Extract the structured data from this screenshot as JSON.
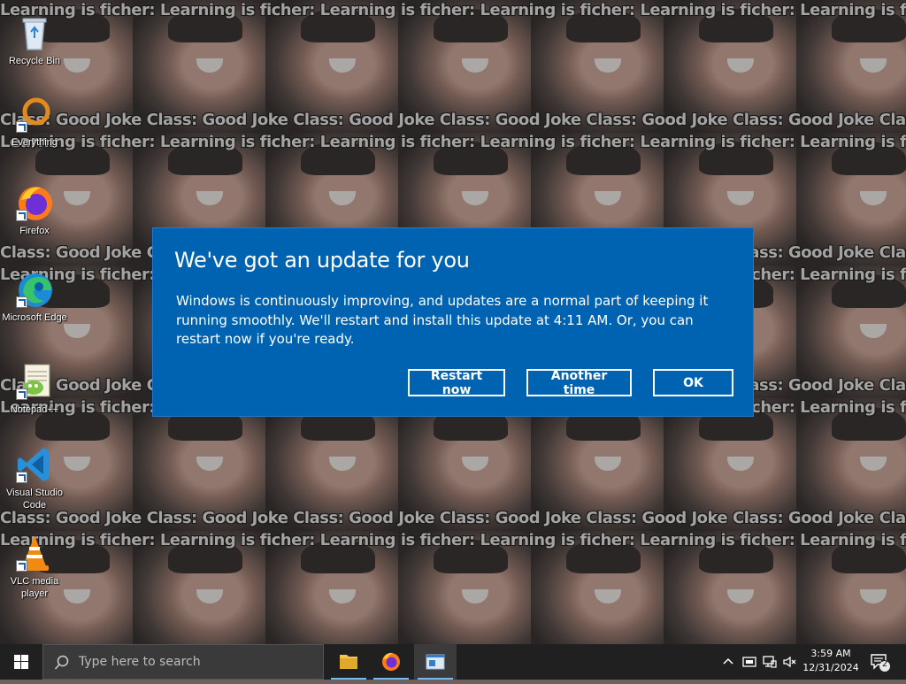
{
  "wallpaper": {
    "caption_a": "Learning is ficher: Learning is ficher: Learning is ficher: Learning is ficher: Learning is ficher: Learning is ficher: Learning is ficher: Learning is ficher:",
    "caption_b": "Class: Good Joke  Class: Good Joke  Class: Good Joke  Class: Good Joke  Class: Good Joke  Class: Good Joke  Class: Good Joke  Class: Good Joke"
  },
  "desktop": {
    "icons": [
      {
        "label": "Recycle Bin",
        "icon": "recycle-bin-icon"
      },
      {
        "label": "Everything",
        "icon": "everything-search-icon"
      },
      {
        "label": "Firefox",
        "icon": "firefox-icon"
      },
      {
        "label": "Microsoft Edge",
        "icon": "edge-icon"
      },
      {
        "label": "Notepad++",
        "icon": "notepad-plus-plus-icon"
      },
      {
        "label": "Visual Studio Code",
        "icon": "vscode-icon"
      },
      {
        "label": "VLC media player",
        "icon": "vlc-icon"
      }
    ]
  },
  "dialog": {
    "title": "We've got an update for you",
    "body": "Windows is continuously improving, and updates are a normal part of keeping it running smoothly. We'll restart and install this update at 4:11 AM. Or, you can restart now if you're ready.",
    "buttons": {
      "restart": "Restart now",
      "another": "Another time",
      "ok": "OK"
    },
    "colors": {
      "background": "#0063b1",
      "text": "#ffffff"
    }
  },
  "taskbar": {
    "search_placeholder": "Type here to search",
    "pinned": [
      "file-explorer-icon",
      "firefox-icon",
      "notepad-window-icon"
    ],
    "tray": [
      "chevron-up-icon",
      "network-icon",
      "display-icon",
      "speaker-muted-icon"
    ],
    "time": "3:59 AM",
    "date": "12/31/2024",
    "notification_count": "2"
  }
}
